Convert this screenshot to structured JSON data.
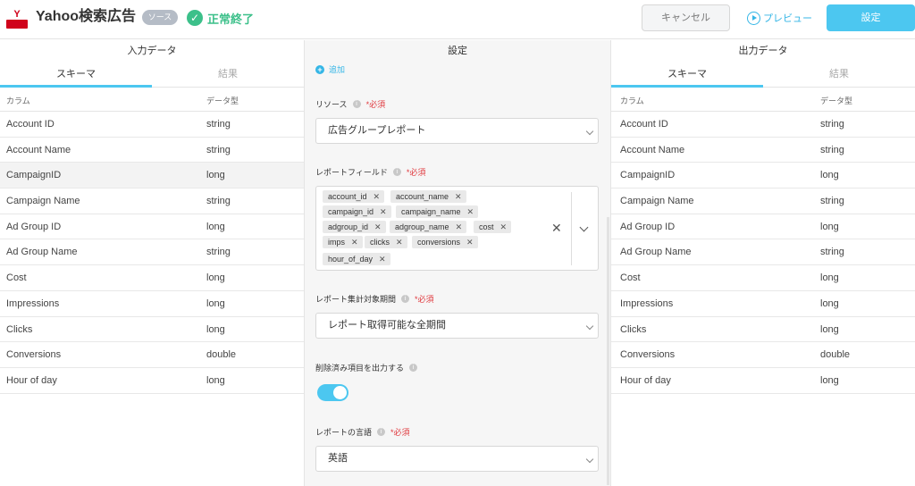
{
  "header": {
    "title": "Yahoo検索広告",
    "logo_text": "Y",
    "badge": "ソース",
    "status": "正常終了",
    "cancel_label": "キャンセル",
    "preview_label": "プレビュー",
    "settings_label": "設定"
  },
  "input_panel": {
    "title": "入力データ",
    "tabs": [
      {
        "label": "スキーマ",
        "active": true
      },
      {
        "label": "結果",
        "active": false
      }
    ],
    "columns": [
      "カラム",
      "データ型"
    ],
    "rows": [
      {
        "name": "Account ID",
        "type": "string"
      },
      {
        "name": "Account Name",
        "type": "string"
      },
      {
        "name": "CampaignID",
        "type": "long"
      },
      {
        "name": "Campaign Name",
        "type": "string"
      },
      {
        "name": "Ad Group ID",
        "type": "long"
      },
      {
        "name": "Ad Group Name",
        "type": "string"
      },
      {
        "name": "Cost",
        "type": "long"
      },
      {
        "name": "Impressions",
        "type": "long"
      },
      {
        "name": "Clicks",
        "type": "long"
      },
      {
        "name": "Conversions",
        "type": "double"
      },
      {
        "name": "Hour of day",
        "type": "long"
      }
    ]
  },
  "settings_panel": {
    "title": "設定",
    "add_label": "追加",
    "required_label": "*必須",
    "resource": {
      "label": "リソース",
      "value": "広告グループレポート"
    },
    "report_fields": {
      "label": "レポートフィールド",
      "chips": [
        "account_id",
        "account_name",
        "campaign_id",
        "campaign_name",
        "adgroup_id",
        "adgroup_name",
        "cost",
        "imps",
        "clicks",
        "conversions",
        "hour_of_day"
      ]
    },
    "period": {
      "label": "レポート集計対象期間",
      "value": "レポート取得可能な全期間"
    },
    "deleted_items": {
      "label": "削除済み項目を出力する",
      "enabled": true
    },
    "language": {
      "label": "レポートの言語",
      "value": "英語"
    }
  },
  "output_panel": {
    "title": "出力データ",
    "tabs": [
      {
        "label": "スキーマ",
        "active": true
      },
      {
        "label": "結果",
        "active": false
      }
    ],
    "columns": [
      "カラム",
      "データ型"
    ],
    "rows": [
      {
        "name": "Account ID",
        "type": "string"
      },
      {
        "name": "Account Name",
        "type": "string"
      },
      {
        "name": "CampaignID",
        "type": "long"
      },
      {
        "name": "Campaign Name",
        "type": "string"
      },
      {
        "name": "Ad Group ID",
        "type": "long"
      },
      {
        "name": "Ad Group Name",
        "type": "string"
      },
      {
        "name": "Cost",
        "type": "long"
      },
      {
        "name": "Impressions",
        "type": "long"
      },
      {
        "name": "Clicks",
        "type": "long"
      },
      {
        "name": "Conversions",
        "type": "double"
      },
      {
        "name": "Hour of day",
        "type": "long"
      }
    ]
  },
  "colors": {
    "accent": "#4cc7f0",
    "success": "#3cc08a",
    "required": "#e0393e",
    "brand": "#d0021b"
  }
}
